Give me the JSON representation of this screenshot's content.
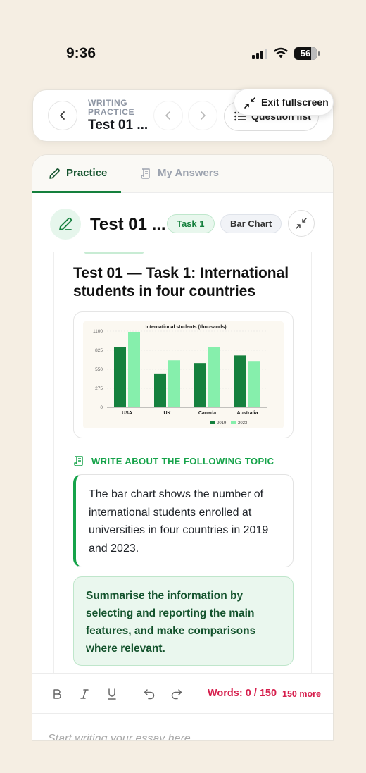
{
  "status": {
    "time": "9:36",
    "battery": "56"
  },
  "header": {
    "crumb_sup": "WRITING PRACTICE",
    "crumb_title": "Test 01 ...",
    "question_list_label": "Question list",
    "exit_fullscreen_label": "Exit fullscreen"
  },
  "tabs": [
    {
      "label": "Practice",
      "active": true
    },
    {
      "label": "My Answers",
      "active": false
    }
  ],
  "task": {
    "title": "Test 01 ...",
    "badge_task": "Task 1",
    "badge_type": "Bar Chart"
  },
  "question": {
    "title": "Test 01 — Task 1: International students in four countries",
    "topic_label": "WRITE ABOUT THE FOLLOWING TOPIC",
    "prompt": "The bar chart shows the number of international students enrolled at universities in four countries in 2019 and 2023.",
    "instruction": "Summarise the information by selecting and reporting the main features, and make comparisons where relevant."
  },
  "chart_data": {
    "type": "bar",
    "title": "International students (thousands)",
    "categories": [
      "USA",
      "UK",
      "Canada",
      "Australia"
    ],
    "series": [
      {
        "name": "2019",
        "values": [
          870,
          480,
          640,
          750
        ],
        "color": "#15803d"
      },
      {
        "name": "2023",
        "values": [
          1090,
          680,
          870,
          660
        ],
        "color": "#86efac"
      }
    ],
    "yticks": [
      0,
      275,
      550,
      825,
      1100
    ],
    "ylim": [
      0,
      1100
    ],
    "legend": "bottom-right"
  },
  "editor": {
    "words": "Words: 0 / 150",
    "more": "150 more",
    "placeholder": "Start writing your essay here..."
  },
  "colors": {
    "accent": "#16a34a",
    "dark_accent": "#14532d",
    "warning": "#d61f4d"
  }
}
